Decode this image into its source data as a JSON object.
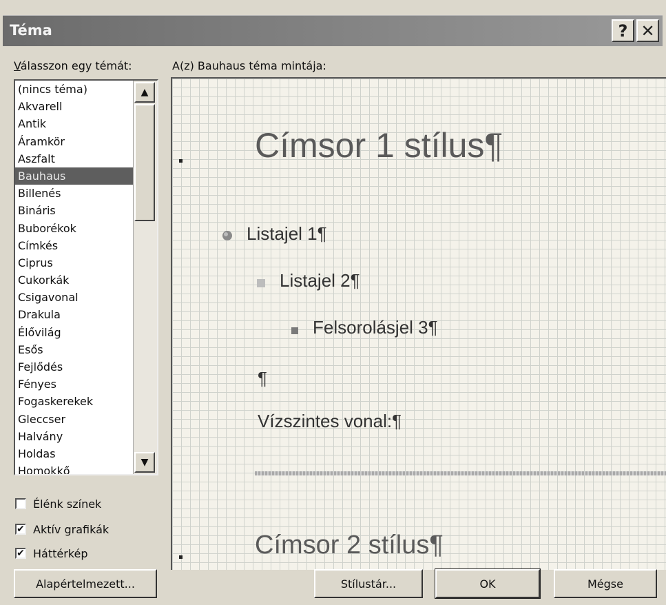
{
  "window": {
    "title": "Téma",
    "help_glyph": "?",
    "close_glyph": "✕"
  },
  "left": {
    "label": "Válasszon egy témát:",
    "themes": [
      "(nincs téma)",
      "Akvarell",
      "Antik",
      "Áramkör",
      "Aszfalt",
      "Bauhaus",
      "Billenés",
      "Bináris",
      "Buborékok",
      "Címkés",
      "Ciprus",
      "Cukorkák",
      "Csigavonal",
      "Drakula",
      "Élővilág",
      "Esős",
      "Fejlődés",
      "Fényes",
      "Fogaskerekek",
      "Gleccser",
      "Halvány",
      "Holdas",
      "Homokkő"
    ],
    "selected": "Bauhaus"
  },
  "options": [
    {
      "label": "Élénk színek",
      "checked": false
    },
    {
      "label": "Aktív grafikák",
      "checked": true
    },
    {
      "label": "Háttérkép",
      "checked": true
    }
  ],
  "preview": {
    "label": "A(z) Bauhaus téma mintája:",
    "heading1": "Címsor 1 stílus¶",
    "bullet1": "Listajel 1¶",
    "bullet2": "Listajel 2¶",
    "bullet3": "Felsorolásjel 3¶",
    "empty_para": "¶",
    "hr_label": "Vízszintes vonal:¶",
    "heading2": "Címsor 2 stílus¶"
  },
  "buttons": {
    "default": "Alapértelmezett...",
    "style_gallery": "Stílustár...",
    "ok": "OK",
    "cancel": "Mégse"
  },
  "colors": {
    "selection": "#5e5e5e",
    "title_bar": "#6b6b6b"
  }
}
